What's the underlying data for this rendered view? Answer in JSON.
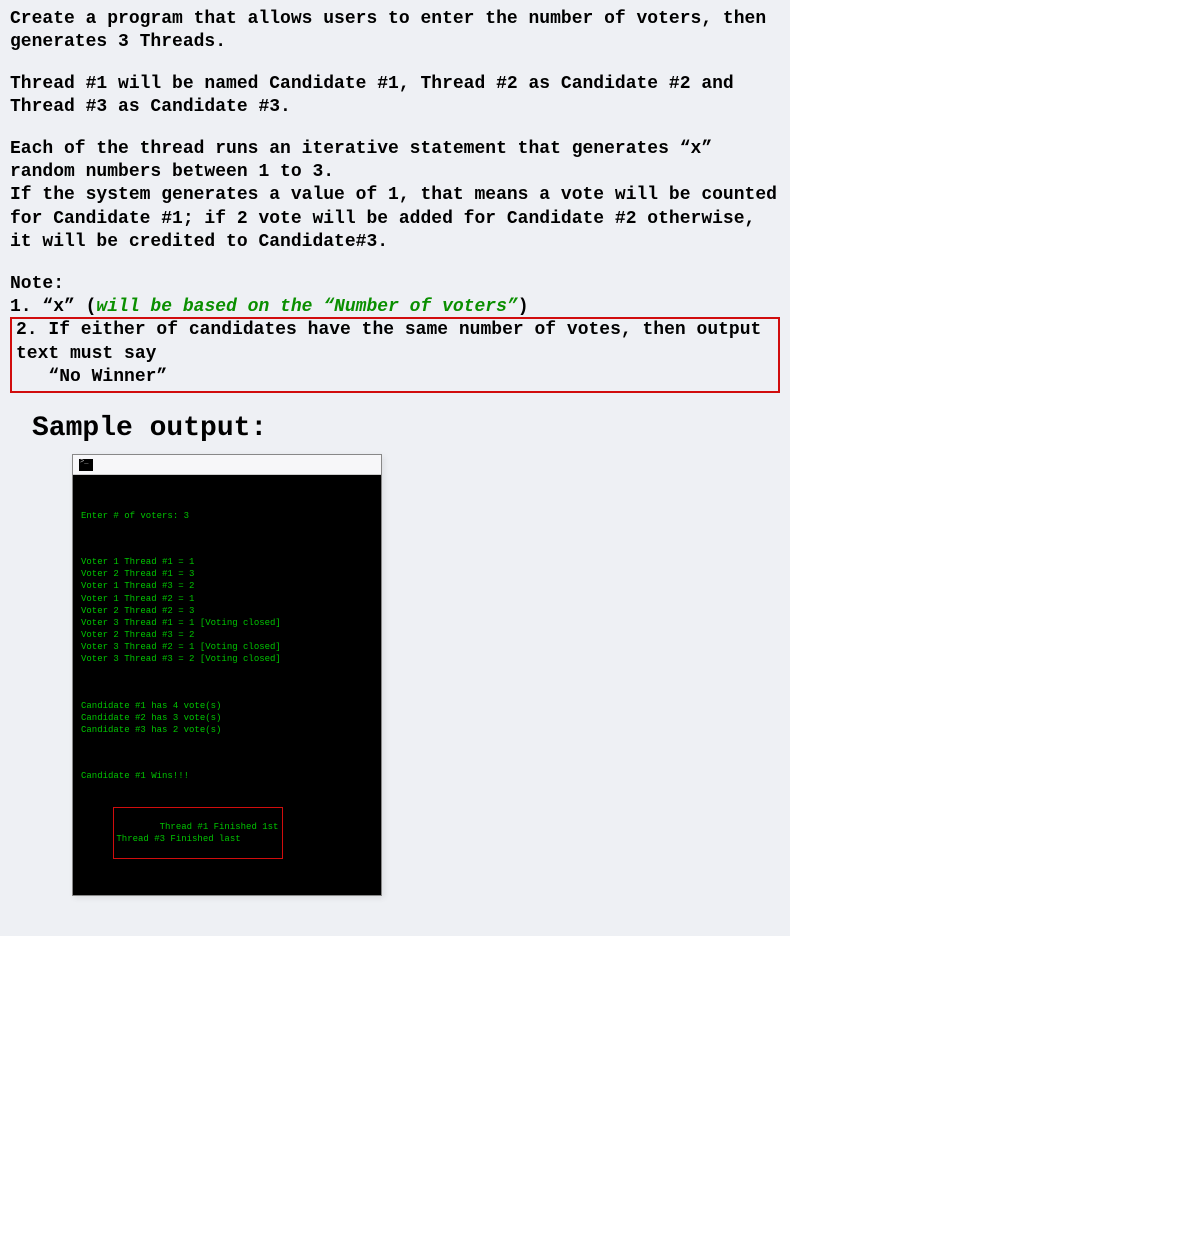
{
  "prose": {
    "p1": "Create a program that allows users to enter the number of voters, then generates 3 Threads.",
    "p2": "Thread #1 will be named Candidate #1, Thread #2 as Candidate #2 and Thread #3 as Candidate #3.",
    "p3": "Each of the thread runs an iterative statement that generates “x” random numbers between 1 to 3.\nIf the system generates a value of 1, that means a vote will be counted for Candidate #1; if 2 vote will be added for Candidate #2 otherwise, it will be credited to Candidate#3."
  },
  "note": {
    "heading": "Note:",
    "item1_prefix": "1. “x” (",
    "item1_italic": "will be based on the “Number of voters”",
    "item1_suffix": ")",
    "item2": "2. If either of candidates have the same number of votes, then output text must say\n   “No Winner”"
  },
  "sample_heading": "Sample output:",
  "console": {
    "prompt": "Enter # of voters: 3",
    "votes": "Voter 1 Thread #1 = 1\nVoter 2 Thread #1 = 3\nVoter 1 Thread #3 = 2\nVoter 1 Thread #2 = 1\nVoter 2 Thread #2 = 3\nVoter 3 Thread #1 = 1 [Voting closed]\nVoter 2 Thread #3 = 2\nVoter 3 Thread #2 = 1 [Voting closed]\nVoter 3 Thread #3 = 2 [Voting closed]",
    "tally": "Candidate #1 has 4 vote(s)\nCandidate #2 has 3 vote(s)\nCandidate #3 has 2 vote(s)",
    "winner": "Candidate #1 Wins!!!",
    "finish": "Thread #1 Finished 1st\nThread #3 Finished last"
  }
}
